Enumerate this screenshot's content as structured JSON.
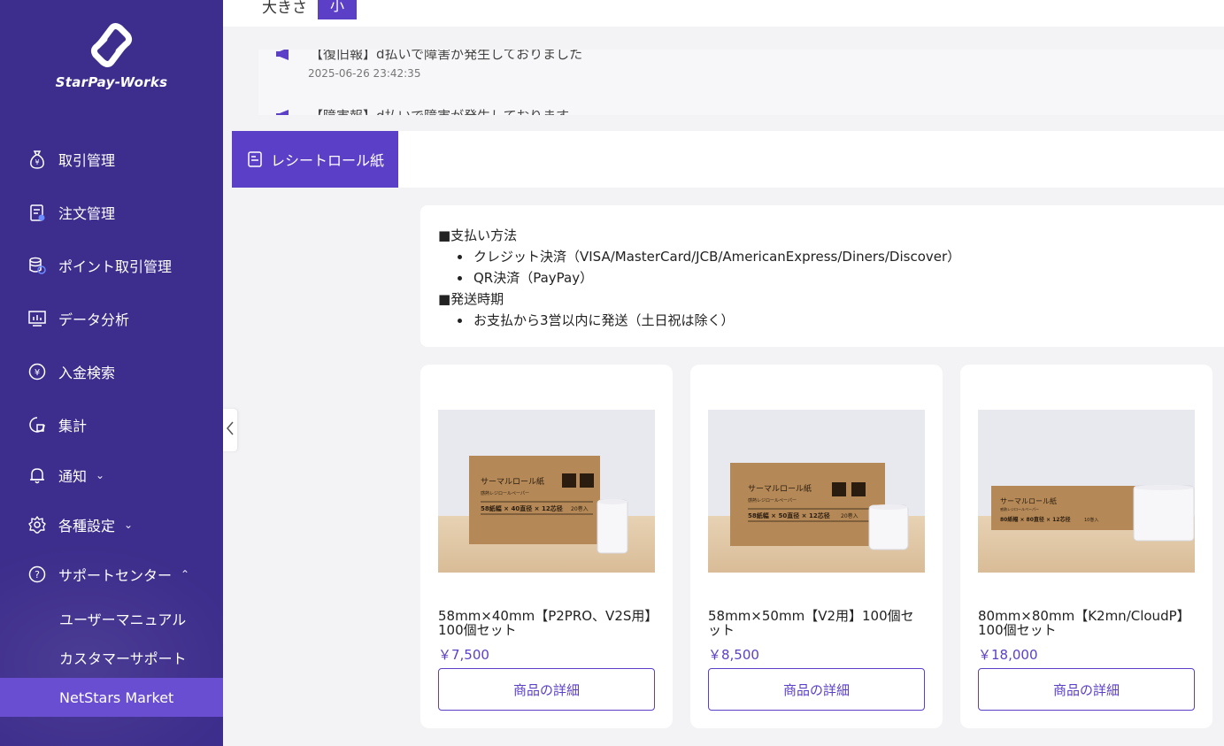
{
  "sidebar": {
    "logo_text": "StarPay-Works",
    "items": [
      {
        "label": "取引管理",
        "icon": "money-bag-icon"
      },
      {
        "label": "注文管理",
        "icon": "order-clipboard-icon"
      },
      {
        "label": "ポイント取引管理",
        "icon": "coins-stack-icon"
      },
      {
        "label": "データ分析",
        "icon": "chart-monitor-icon"
      },
      {
        "label": "入金検索",
        "icon": "yen-circle-icon"
      },
      {
        "label": "集計",
        "icon": "pie-chart-icon"
      },
      {
        "label": "通知",
        "icon": "bell-icon",
        "chevron": "⌄"
      },
      {
        "label": "各種設定",
        "icon": "gear-icon",
        "chevron": "⌄"
      },
      {
        "label": "サポートセンター",
        "icon": "help-circle-icon",
        "chevron": "⌃"
      }
    ],
    "sub_items": [
      {
        "label": "ユーザーマニュアル"
      },
      {
        "label": "カスタマーサポート"
      },
      {
        "label": "NetStars Market"
      }
    ]
  },
  "topbar": {
    "size_label": "大きさ",
    "size_value": "小"
  },
  "notices": [
    {
      "title": "【復旧報】d払いで障害が発生しておりました",
      "date": "2025-06-26 23:42:35"
    },
    {
      "title": "【障害報】d払いで障害が発生しております"
    }
  ],
  "tab": {
    "label": "レシートロール紙"
  },
  "info": {
    "payment_heading": "■支払い方法",
    "payment_methods": [
      "クレジット決済（VISA/MasterCard/JCB/AmericanExpress/Diners/Discover）",
      "QR決済（PayPay）"
    ],
    "shipping_heading": "■発送時期",
    "shipping_notes": [
      "お支払から3営以内に発送（土日祝は除く）"
    ]
  },
  "products": [
    {
      "name": "58mm×40mm【P2PRO、V2S用】100個セット",
      "price": "￥7,500",
      "button": "商品の詳細",
      "box_title": "サーマルロール紙",
      "box_sub": "感熱レジロールペーパー",
      "box_size": "58紙幅 × 40直径 × 12芯径",
      "box_count": "20巻入"
    },
    {
      "name": "58mm×50mm【V2用】100個セット",
      "price": "￥8,500",
      "button": "商品の詳細",
      "box_title": "サーマルロール紙",
      "box_sub": "感熱レジロールペーパー",
      "box_size": "58紙幅 × 50直径 × 12芯径",
      "box_count": "20巻入"
    },
    {
      "name": "80mm×80mm【K2mn/CloudP】100個セット",
      "price": "￥18,000",
      "button": "商品の詳細",
      "box_title": "サーマルロール紙",
      "box_sub": "感熱レジロールペーパー",
      "box_size": "80紙幅 × 80直径 × 12芯径",
      "box_count": "10巻入"
    }
  ],
  "colors": {
    "sidebar": "#3d2d8c",
    "accent": "#5b3fc6",
    "active_sub": "#6a4ed1"
  }
}
